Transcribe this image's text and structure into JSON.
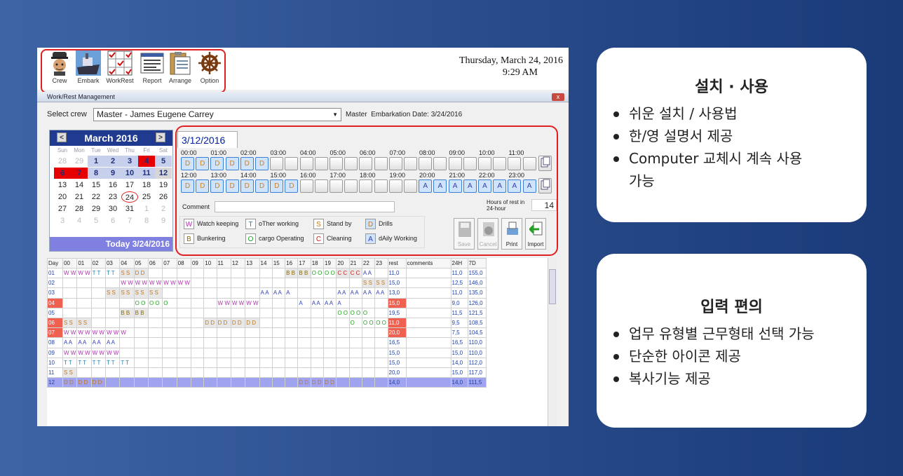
{
  "toolbar": {
    "buttons": [
      "Crew",
      "Embark",
      "WorkRest",
      "Report",
      "Arrange",
      "Option"
    ],
    "date": "Thursday, March 24, 2016",
    "time": "9:29 AM"
  },
  "window": {
    "title": "Work/Rest Management",
    "close": "x"
  },
  "crew": {
    "label": "Select crew",
    "selected": "Master - James Eugene Carrey",
    "rank": "Master",
    "embarkation": "Embarkation Date: 3/24/2016"
  },
  "calendar": {
    "month": "March 2016",
    "prev": "<",
    "next": ">",
    "days": [
      "Sun",
      "Mon",
      "Tue",
      "Wed",
      "Thu",
      "Fri",
      "Sat"
    ],
    "cells": [
      [
        "28",
        "gr"
      ],
      [
        "29",
        "gr"
      ],
      [
        "1",
        "b"
      ],
      [
        "2",
        "b"
      ],
      [
        "3",
        "b"
      ],
      [
        "4",
        "r"
      ],
      [
        "5",
        "b"
      ],
      [
        "6",
        "r"
      ],
      [
        "7",
        "r"
      ],
      [
        "8",
        "b"
      ],
      [
        "9",
        "b"
      ],
      [
        "10",
        "b"
      ],
      [
        "11",
        "b"
      ],
      [
        "12",
        "g"
      ],
      [
        "13",
        ""
      ],
      [
        "14",
        ""
      ],
      [
        "15",
        ""
      ],
      [
        "16",
        ""
      ],
      [
        "17",
        ""
      ],
      [
        "18",
        ""
      ],
      [
        "19",
        ""
      ],
      [
        "20",
        ""
      ],
      [
        "21",
        ""
      ],
      [
        "22",
        ""
      ],
      [
        "23",
        ""
      ],
      [
        "24",
        "circ"
      ],
      [
        "25",
        ""
      ],
      [
        "26",
        ""
      ],
      [
        "27",
        ""
      ],
      [
        "28",
        ""
      ],
      [
        "29",
        ""
      ],
      [
        "30",
        ""
      ],
      [
        "31",
        ""
      ],
      [
        "1",
        "gr"
      ],
      [
        "2",
        "gr"
      ],
      [
        "3",
        "gr"
      ],
      [
        "4",
        "gr"
      ],
      [
        "5",
        "gr"
      ],
      [
        "6",
        "gr"
      ],
      [
        "7",
        "gr"
      ],
      [
        "8",
        "gr"
      ],
      [
        "9",
        "gr"
      ]
    ],
    "today": "Today  3/24/2016"
  },
  "day": {
    "date": "3/12/2016",
    "times_am": [
      "00:00",
      "01:00",
      "02:00",
      "03:00",
      "04:00",
      "05:00",
      "06:00",
      "07:00",
      "08:00",
      "09:00",
      "10:00",
      "11:00"
    ],
    "times_pm": [
      "12:00",
      "13:00",
      "14:00",
      "15:00",
      "16:00",
      "17:00",
      "18:00",
      "19:00",
      "20:00",
      "21:00",
      "22:00",
      "23:00"
    ],
    "slots_am": "DDDDDD..................",
    "slots_pm": "....DDDDDDDD........AAAAAAAA",
    "comment_label": "Comment",
    "hours_label": "Hours of rest in 24-hour",
    "hours_value": "14"
  },
  "legend": [
    [
      "W",
      "Watch keeping"
    ],
    [
      "T",
      "oTher working"
    ],
    [
      "S",
      "Stand by"
    ],
    [
      "D",
      "Drills"
    ],
    [
      "B",
      "Bunkering"
    ],
    [
      "O",
      "cargo Operating"
    ],
    [
      "C",
      "Cleaning"
    ],
    [
      "A",
      "dAily Working"
    ]
  ],
  "actions": [
    "Save",
    "Cancel",
    "Print",
    "Import"
  ],
  "table": {
    "headers": [
      "Day",
      "00",
      "01",
      "02",
      "03",
      "04",
      "05",
      "06",
      "07",
      "08",
      "09",
      "10",
      "11",
      "12",
      "13",
      "14",
      "15",
      "16",
      "17",
      "18",
      "19",
      "20",
      "21",
      "22",
      "23",
      "rest",
      "comments",
      "24H",
      "7D"
    ],
    "rows": [
      {
        "day": "01",
        "s": "WWWWTTTTSSDD....................BBBBOOOOCCCCAA......................",
        "rest": "11,0",
        "h24": "11,0",
        "d7": "155,0"
      },
      {
        "day": "02",
        "s": "........WWWWWWWWWW..........................SSSSSSSSSS..............",
        "rest": "15,0",
        "h24": "12,5",
        "d7": "146,0"
      },
      {
        "day": "03",
        "s": "......SSSSSSSS..............AAAAA.......AAAAAAAAAA..............",
        "rest": "13,0",
        "h24": "11,0",
        "d7": "135,0"
      },
      {
        "day": "04",
        "s": "..........OOOOO.......WWWWWW.......AAAAAA.........................",
        "rest": "15,0",
        "h24": "9,0",
        "d7": "126,0",
        "hl": true
      },
      {
        "day": "05",
        "s": "........BBBB............................OOOOO..................",
        "rest": "19,5",
        "h24": "11,5",
        "d7": "121,5"
      },
      {
        "day": "06",
        "s": "SSSS................DDDDDDDD...............OOOOOOO......AAAAAAAA",
        "rest": "11,0",
        "h24": "9,5",
        "d7": "108,5",
        "hl": true
      },
      {
        "day": "07",
        "s": "WWWWWWWWW.....................................................",
        "rest": "20,0",
        "h24": "7,5",
        "d7": "104,5",
        "hl": true
      },
      {
        "day": "08",
        "s": "AAAAAAAA........................................SSSSSSSS..........",
        "rest": "16,5",
        "h24": "16,5",
        "d7": "110,0"
      },
      {
        "day": "09",
        "s": "WWWWWWWW........................................................WWWWWWWWWW",
        "rest": "15,0",
        "h24": "15,0",
        "d7": "110,0"
      },
      {
        "day": "10",
        "s": "TTTTTTTTTT..............................................TTTTTTTTT",
        "rest": "15,0",
        "h24": "14,0",
        "d7": "112,0"
      },
      {
        "day": "11",
        "s": "SS......................................................OOOOOOO",
        "rest": "20,0",
        "h24": "15,0",
        "d7": "117,0"
      },
      {
        "day": "12",
        "s": "DDDDDD............................DDDDDD..........AAAAAAAA",
        "rest": "14,0",
        "h24": "14,0",
        "d7": "111,5",
        "sel": true
      }
    ]
  },
  "cards": [
    {
      "title": "설치 · 사용",
      "items": [
        "쉬운 설치 / 사용법",
        "한/영 설명서 제공",
        "Computer 교체시 계속 사용 가능"
      ]
    },
    {
      "title": "입력 편의",
      "items": [
        "업무 유형별 근무형태 선택 가능",
        "단순한 아이콘 제공",
        "복사기능 제공"
      ]
    }
  ]
}
